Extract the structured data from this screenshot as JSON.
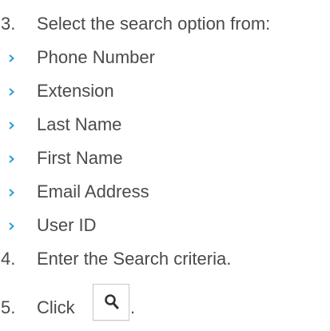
{
  "steps": [
    {
      "number": "3.",
      "text": "Select the search option from:"
    },
    {
      "number": "4.",
      "text": "Enter the Search criteria."
    },
    {
      "number": "5.",
      "text": "Click",
      "after_icon": "."
    }
  ],
  "options": [
    "Phone Number",
    "Extension",
    "Last Name",
    "First Name",
    "Email Address",
    "User ID"
  ],
  "search_button": {
    "icon": "magnifier-icon"
  },
  "colors": {
    "text": "#4a4a4a",
    "bullet": "#2a9fd6",
    "icon": "#333333",
    "button_border": "#c9c9c9"
  }
}
